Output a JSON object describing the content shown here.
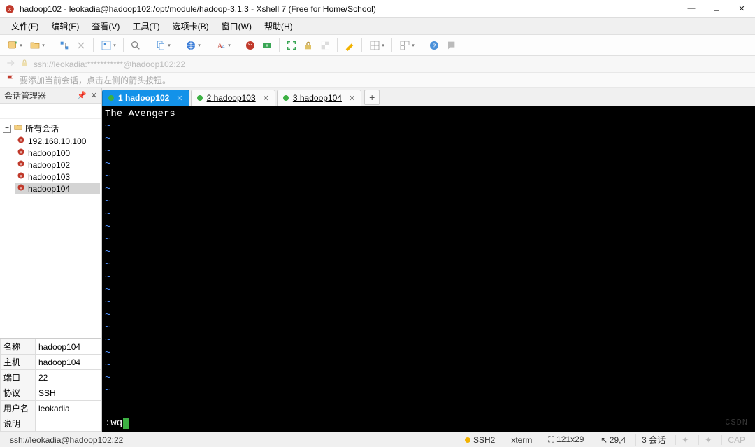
{
  "window": {
    "title": "hadoop102 - leokadia@hadoop102:/opt/module/hadoop-3.1.3 - Xshell 7 (Free for Home/School)"
  },
  "menu": {
    "file": "文件(F)",
    "edit": "编辑(E)",
    "view": "查看(V)",
    "tools": "工具(T)",
    "tab": "选项卡(B)",
    "window": "窗口(W)",
    "help": "帮助(H)"
  },
  "addressbar": {
    "text": "ssh://leokadia:***********@hadoop102:22"
  },
  "infobar": {
    "text": "要添加当前会话，点击左侧的箭头按钮。"
  },
  "session_panel": {
    "title": "会话管理器",
    "root": "所有会话",
    "sessions": [
      {
        "name": "192.168.10.100"
      },
      {
        "name": "hadoop100"
      },
      {
        "name": "hadoop102"
      },
      {
        "name": "hadoop103"
      },
      {
        "name": "hadoop104",
        "selected": true
      }
    ],
    "props": [
      {
        "k": "名称",
        "v": "hadoop104"
      },
      {
        "k": "主机",
        "v": "hadoop104"
      },
      {
        "k": "端口",
        "v": "22"
      },
      {
        "k": "协议",
        "v": "SSH"
      },
      {
        "k": "用户名",
        "v": "leokadia"
      },
      {
        "k": "说明",
        "v": ""
      }
    ]
  },
  "tabs": {
    "items": [
      {
        "label": "1 hadoop102",
        "active": true
      },
      {
        "label": "2 hadoop103"
      },
      {
        "label": "3 hadoop104"
      }
    ]
  },
  "terminal": {
    "top_line": "The Avengers",
    "tilde_rows": 22,
    "command": ":wq"
  },
  "statusbar": {
    "path": "ssh://leokadia@hadoop102:22",
    "ssh": "SSH2",
    "term": "xterm",
    "size": "121x29",
    "cursor": "29,4",
    "sessions": "3 会话",
    "cap": "CAP"
  },
  "watermark": "CSDN"
}
